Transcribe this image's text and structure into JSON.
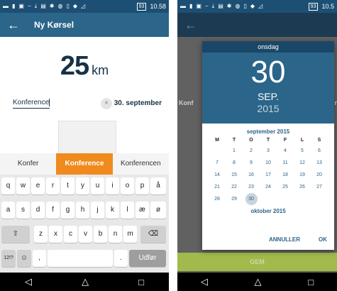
{
  "left": {
    "status": {
      "time": "10.58",
      "battery": "93",
      "icons": [
        "message-icon",
        "sim-icon",
        "image-icon",
        "minus-icon",
        "download-icon",
        "nfc-icon",
        "bluetooth-icon",
        "vibrate-icon",
        "phone-icon",
        "wifi-icon",
        "signal-icon"
      ]
    },
    "appbar": {
      "back_icon": "←",
      "title": "Ny Kørsel"
    },
    "distance": {
      "value": "25",
      "unit": "km"
    },
    "purpose": {
      "value": "Konference",
      "clear_icon": "×"
    },
    "date": "30. september",
    "suggestions": [
      "Konfer",
      "Konference",
      "Konferencen"
    ],
    "keyboard": {
      "row1": [
        "q",
        "w",
        "e",
        "r",
        "t",
        "y",
        "u",
        "i",
        "o",
        "p",
        "å"
      ],
      "row2": [
        "a",
        "s",
        "d",
        "f",
        "g",
        "h",
        "j",
        "k",
        "l",
        "æ",
        "ø"
      ],
      "row3": [
        "⇧",
        "z",
        "x",
        "c",
        "v",
        "b",
        "n",
        "m",
        "⌫"
      ],
      "row4": {
        "sym": "12!?",
        "emoji": "☺",
        "comma": ",",
        "period": ".",
        "action": "Udfør"
      }
    },
    "nav": {
      "back": "◁",
      "home": "△",
      "recents": "□"
    }
  },
  "right": {
    "status": {
      "time": "10.5",
      "battery": "93"
    },
    "appbar": {
      "back_icon": "←"
    },
    "dim_labels": {
      "left": "Konf",
      "right": "mber"
    },
    "gem": "GEM",
    "picker": {
      "weekday": "onsdag",
      "day": "30",
      "month": "SEP.",
      "year": "2015",
      "calendar_title": "september 2015",
      "weekday_headers": [
        "M",
        "T",
        "O",
        "T",
        "F",
        "L",
        "S"
      ],
      "weeks": [
        [
          "",
          "1",
          "2",
          "3",
          "4",
          "5",
          "6"
        ],
        [
          "7",
          "8",
          "9",
          "10",
          "11",
          "12",
          "13"
        ],
        [
          "14",
          "15",
          "16",
          "17",
          "18",
          "19",
          "20"
        ],
        [
          "21",
          "22",
          "23",
          "24",
          "25",
          "26",
          "27"
        ],
        [
          "28",
          "29",
          "30",
          "",
          "",
          "",
          ""
        ]
      ],
      "selected_day": "30",
      "next_month_title": "oktober 2015",
      "cancel": "ANNULLER",
      "ok": "OK"
    },
    "nav": {
      "back": "◁",
      "home": "△",
      "recents": "□"
    }
  }
}
